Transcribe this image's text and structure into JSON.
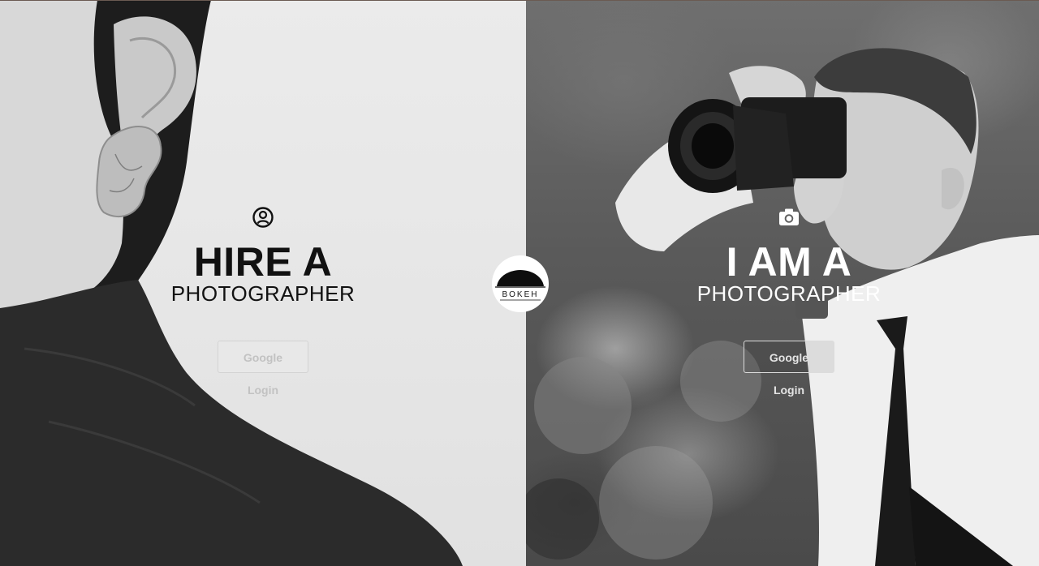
{
  "brand": {
    "name": "BOKEH"
  },
  "hire": {
    "icon": "user-circle-icon",
    "title": "HIRE A",
    "subtitle": "PHOTOGRAPHER",
    "button_label": "Google Login"
  },
  "photographer": {
    "icon": "camera-icon",
    "title": "I AM A",
    "subtitle": "PHOTOGRAPHER",
    "button_label": "Google Login"
  },
  "colors": {
    "left_text": "#111111",
    "right_text": "#ffffff",
    "divider": "#6b5a52"
  }
}
